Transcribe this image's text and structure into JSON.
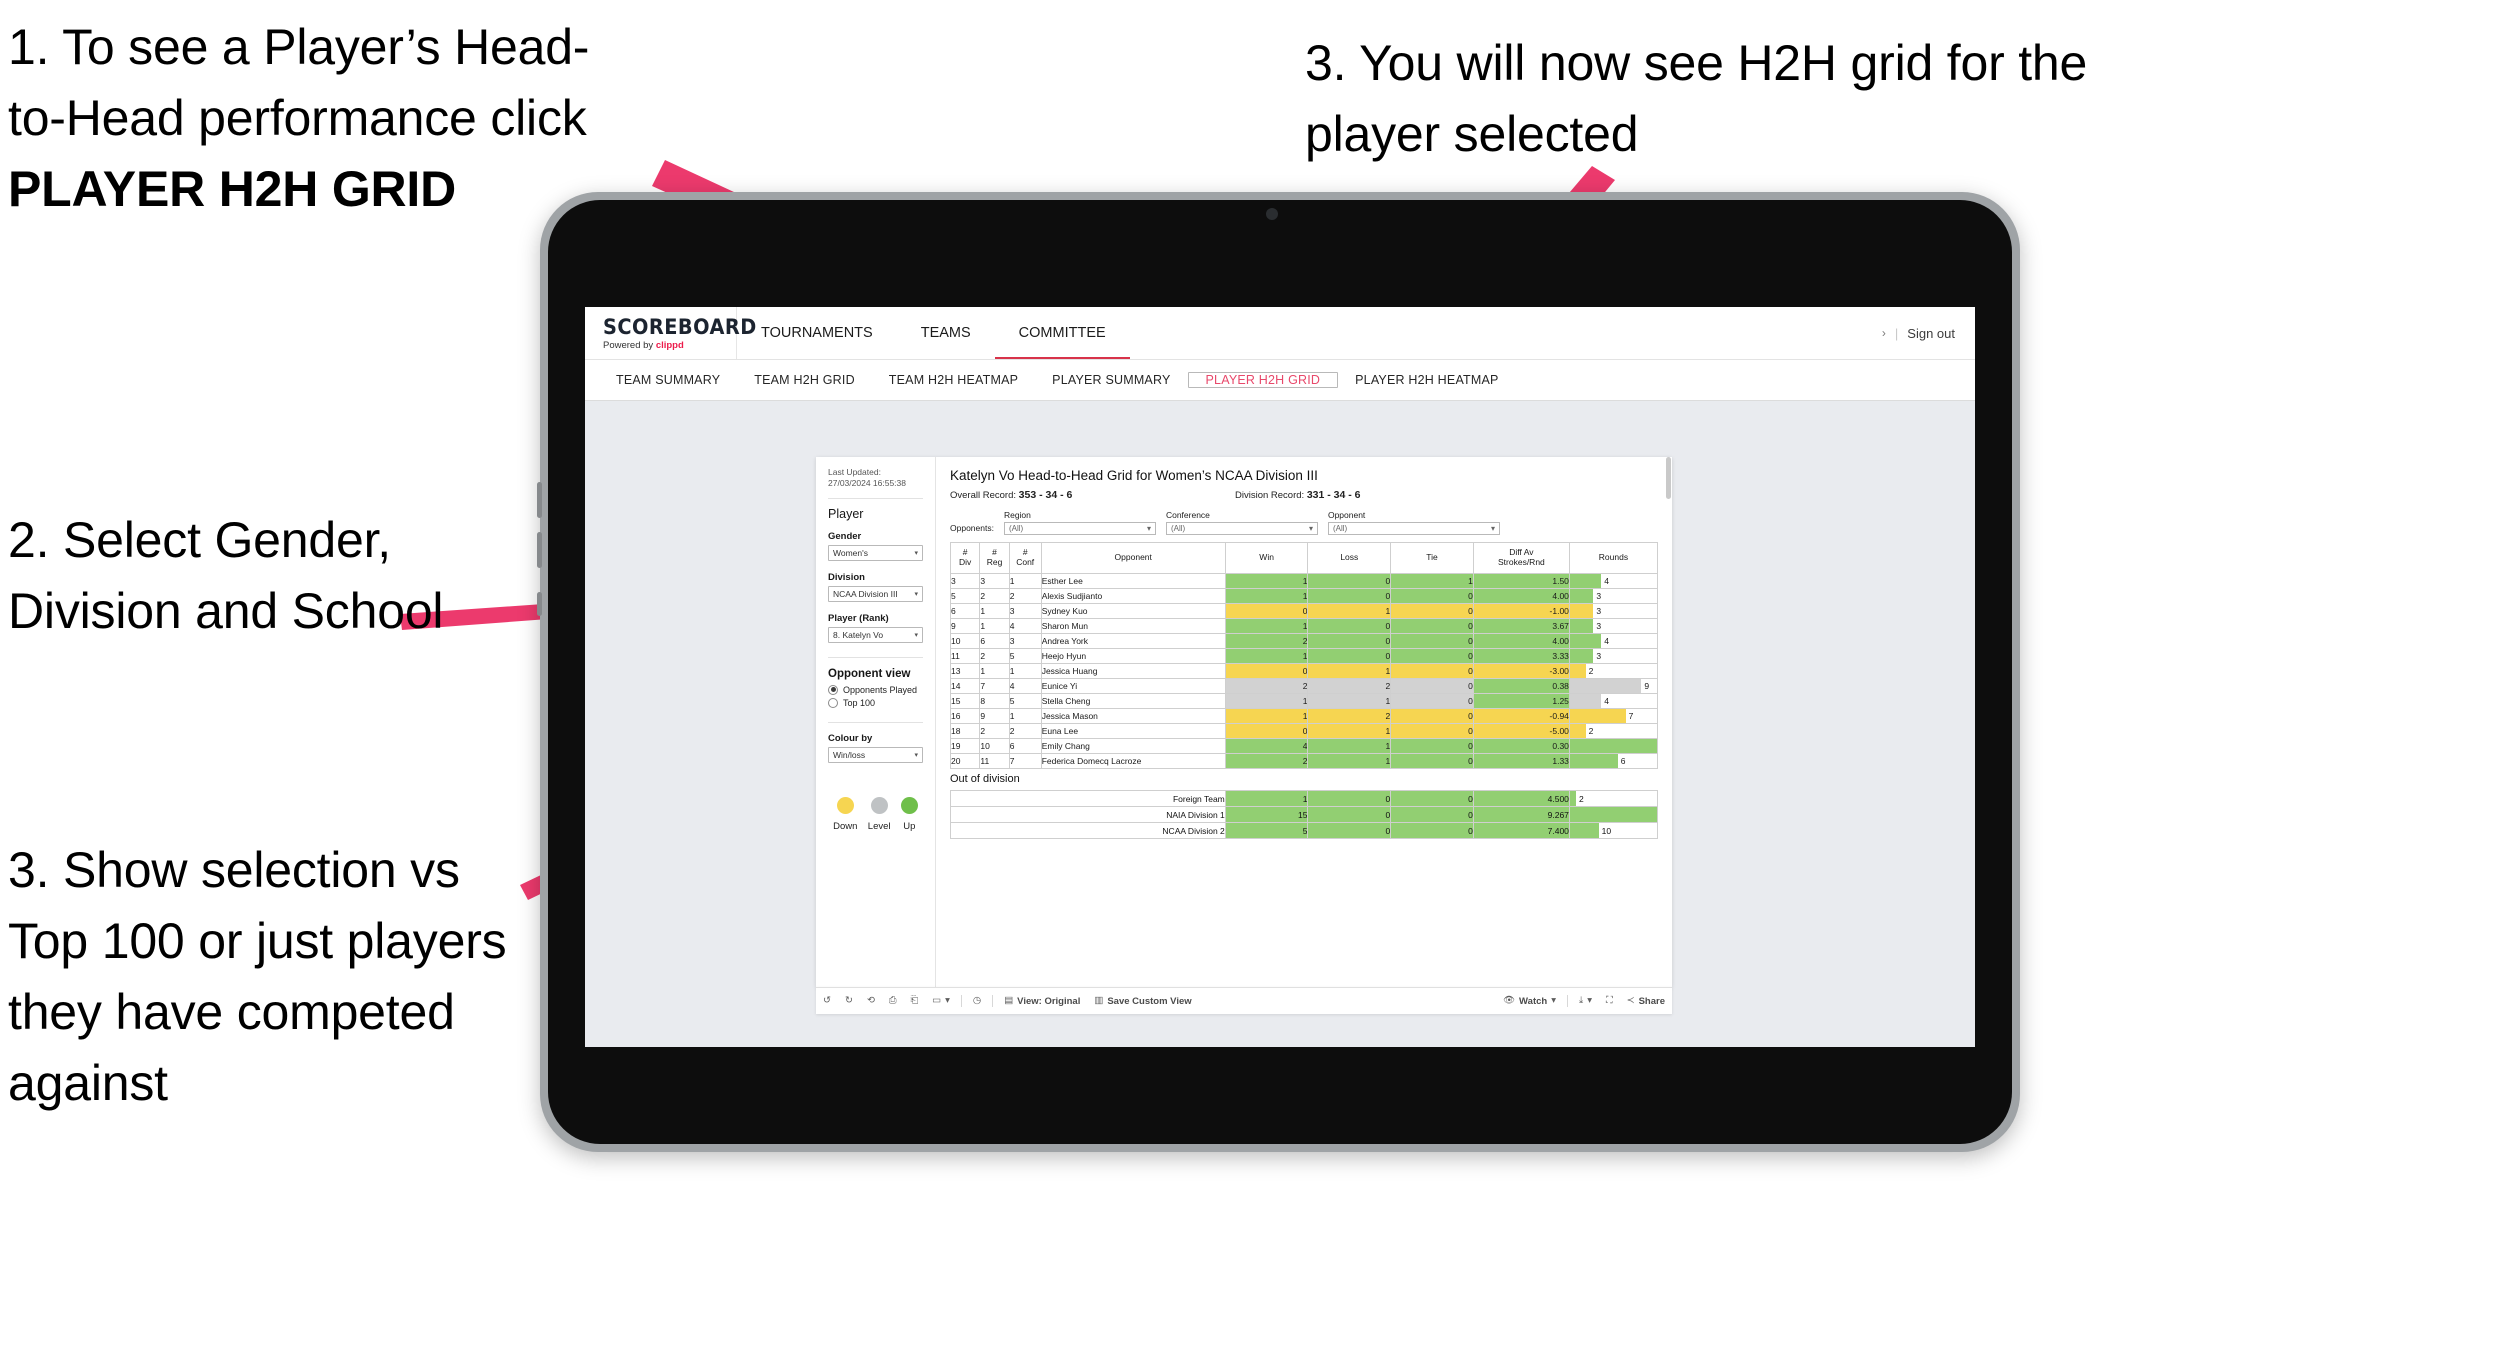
{
  "annotations": [
    {
      "id": "anno-1",
      "line1": "1. To see a Player’s Head-",
      "line2": "to-Head performance click",
      "bold": "PLAYER H2H GRID"
    },
    {
      "id": "anno-2",
      "text": "2. Select Gender, Division and School"
    },
    {
      "id": "anno-3",
      "text": "3. You will now see H2H grid for the player selected"
    },
    {
      "id": "anno-4",
      "text": "3. Show selection vs Top 100 or just players they have competed against"
    }
  ],
  "app": {
    "brand": {
      "name": "SCOREBOARD",
      "powered_by": "Powered by ",
      "powered_brand": "clippd"
    },
    "topnav": [
      {
        "label": "TOURNAMENTS",
        "active": false
      },
      {
        "label": "TEAMS",
        "active": false
      },
      {
        "label": "COMMITTEE",
        "active": true
      }
    ],
    "account": {
      "chevron": "›",
      "divider": "|",
      "sign_out": "Sign out"
    },
    "subnav": [
      {
        "label": "TEAM SUMMARY",
        "selected": false
      },
      {
        "label": "TEAM H2H GRID",
        "selected": false
      },
      {
        "label": "TEAM H2H HEATMAP",
        "selected": false
      },
      {
        "label": "PLAYER SUMMARY",
        "selected": false
      },
      {
        "label": "PLAYER H2H GRID",
        "selected": true
      },
      {
        "label": "PLAYER H2H HEATMAP",
        "selected": false
      }
    ]
  },
  "sidebar": {
    "last_updated": "Last Updated: 27/03/2024 16:55:38",
    "section_player": "Player",
    "fields": [
      {
        "label": "Gender",
        "value": "Women's"
      },
      {
        "label": "Division",
        "value": "NCAA Division III"
      },
      {
        "label": "Player (Rank)",
        "value": "8. Katelyn Vo"
      }
    ],
    "opponent_view": {
      "title": "Opponent view",
      "options": [
        {
          "label": "Opponents Played",
          "selected": true
        },
        {
          "label": "Top 100",
          "selected": false
        }
      ]
    },
    "colour_by": {
      "label": "Colour by",
      "value": "Win/loss"
    },
    "legend": [
      {
        "caption": "Down",
        "color": "#f6d551"
      },
      {
        "caption": "Level",
        "color": "#bfc2c4"
      },
      {
        "caption": "Up",
        "color": "#6fbf4a"
      }
    ]
  },
  "view": {
    "title": "Katelyn Vo Head-to-Head Grid for Women’s NCAA Division III",
    "overall_record_label": "Overall Record: ",
    "overall_record": "353 - 34 - 6",
    "division_record_label": "Division Record: ",
    "division_record": "331 - 34 - 6",
    "opponents_prefix": "Opponents:",
    "filters": [
      {
        "label": "Region",
        "value": "(All)"
      },
      {
        "label": "Conference",
        "value": "(All)"
      },
      {
        "label": "Opponent",
        "value": "(All)"
      }
    ]
  },
  "chart_data": {
    "type": "table",
    "title": "Katelyn Vo Head-to-Head Grid for Women’s NCAA Division III",
    "columns": [
      "# Div",
      "# Reg",
      "# Conf",
      "Opponent",
      "Win",
      "Loss",
      "Tie",
      "Diff Av Strokes/Rnd",
      "Rounds"
    ],
    "column_headers_multiline": [
      [
        "#",
        "Div"
      ],
      [
        "#",
        "Reg"
      ],
      [
        "#",
        "Conf"
      ],
      [
        "Opponent"
      ],
      [
        "Win"
      ],
      [
        "Loss"
      ],
      [
        "Tie"
      ],
      [
        "Diff Av",
        "Strokes/Rnd"
      ],
      [
        "Rounds"
      ]
    ],
    "rounds_max": 11,
    "rows": [
      {
        "div": "3",
        "reg": "3",
        "conf": "1",
        "opponent": "Esther Lee",
        "win": "1",
        "loss": "0",
        "tie": "1",
        "diff": "1.50",
        "rounds": 4,
        "color": "g"
      },
      {
        "div": "5",
        "reg": "2",
        "conf": "2",
        "opponent": "Alexis Sudjianto",
        "win": "1",
        "loss": "0",
        "tie": "0",
        "diff": "4.00",
        "rounds": 3,
        "color": "g"
      },
      {
        "div": "6",
        "reg": "1",
        "conf": "3",
        "opponent": "Sydney Kuo",
        "win": "0",
        "loss": "1",
        "tie": "0",
        "diff": "-1.00",
        "rounds": 3,
        "color": "y"
      },
      {
        "div": "9",
        "reg": "1",
        "conf": "4",
        "opponent": "Sharon Mun",
        "win": "1",
        "loss": "0",
        "tie": "0",
        "diff": "3.67",
        "rounds": 3,
        "color": "g"
      },
      {
        "div": "10",
        "reg": "6",
        "conf": "3",
        "opponent": "Andrea York",
        "win": "2",
        "loss": "0",
        "tie": "0",
        "diff": "4.00",
        "rounds": 4,
        "color": "g"
      },
      {
        "div": "11",
        "reg": "2",
        "conf": "5",
        "opponent": "Heejo Hyun",
        "win": "1",
        "loss": "0",
        "tie": "0",
        "diff": "3.33",
        "rounds": 3,
        "color": "g"
      },
      {
        "div": "13",
        "reg": "1",
        "conf": "1",
        "opponent": "Jessica Huang",
        "win": "0",
        "loss": "1",
        "tie": "0",
        "diff": "-3.00",
        "rounds": 2,
        "color": "y"
      },
      {
        "div": "14",
        "reg": "7",
        "conf": "4",
        "opponent": "Eunice Yi",
        "win": "2",
        "loss": "2",
        "tie": "0",
        "diff": "0.38",
        "rounds": 9,
        "color": "gr",
        "diff_color": "g"
      },
      {
        "div": "15",
        "reg": "8",
        "conf": "5",
        "opponent": "Stella Cheng",
        "win": "1",
        "loss": "1",
        "tie": "0",
        "diff": "1.25",
        "rounds": 4,
        "color": "gr",
        "diff_color": "g"
      },
      {
        "div": "16",
        "reg": "9",
        "conf": "1",
        "opponent": "Jessica Mason",
        "win": "1",
        "loss": "2",
        "tie": "0",
        "diff": "-0.94",
        "rounds": 7,
        "color": "y"
      },
      {
        "div": "18",
        "reg": "2",
        "conf": "2",
        "opponent": "Euna Lee",
        "win": "0",
        "loss": "1",
        "tie": "0",
        "diff": "-5.00",
        "rounds": 2,
        "color": "y"
      },
      {
        "div": "19",
        "reg": "10",
        "conf": "6",
        "opponent": "Emily Chang",
        "win": "4",
        "loss": "1",
        "tie": "0",
        "diff": "0.30",
        "rounds": 11,
        "color": "g"
      },
      {
        "div": "20",
        "reg": "11",
        "conf": "7",
        "opponent": "Federica Domecq Lacroze",
        "win": "2",
        "loss": "1",
        "tie": "0",
        "diff": "1.33",
        "rounds": 6,
        "color": "g"
      }
    ],
    "out_of_division": {
      "title": "Out of division",
      "rounds_max": 30,
      "rows": [
        {
          "label": "Foreign Team",
          "win": "1",
          "loss": "0",
          "tie": "0",
          "diff": "4.500",
          "rounds": 2,
          "color": "g"
        },
        {
          "label": "NAIA Division 1",
          "win": "15",
          "loss": "0",
          "tie": "0",
          "diff": "9.267",
          "rounds": 30,
          "color": "g"
        },
        {
          "label": "NCAA Division 2",
          "win": "5",
          "loss": "0",
          "tie": "0",
          "diff": "7.400",
          "rounds": 10,
          "color": "g"
        }
      ]
    }
  },
  "toolbar": {
    "undo": "undo-icon",
    "redo": "redo-icon",
    "revert": "revert-icon",
    "refresh": "refresh-data-icon",
    "pause": "pause-icon",
    "layout": "layout-icon",
    "layout_caret": "▾",
    "clock": "clock-icon",
    "view_label": "View: Original",
    "save_label": "Save Custom View",
    "watch_label": "Watch",
    "watch_caret": "▾",
    "device_caret": "▾",
    "fullscreen": "fullscreen-icon",
    "share_label": "Share"
  }
}
